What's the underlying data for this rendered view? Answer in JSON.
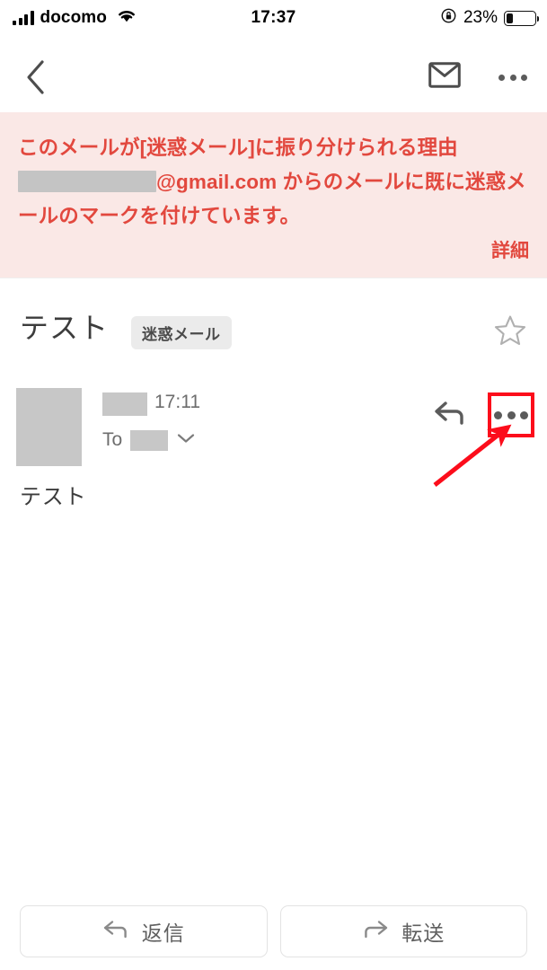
{
  "status_bar": {
    "carrier": "docomo",
    "time": "17:37",
    "battery_percent": "23%",
    "battery_level": 23,
    "signal_icon": "signal-bars-icon",
    "wifi_icon": "wifi-icon",
    "rotation_lock_icon": "rotation-lock-icon"
  },
  "nav_bar": {
    "back_icon": "chevron-left-icon",
    "mail_icon": "envelope-icon",
    "overflow_icon": "more-horizontal-icon"
  },
  "warning_banner": {
    "line1": "このメールが[迷惑メール]に振り分けられる理由",
    "redacted_address_suffix": "@gmail.com からのメールに既に迷惑メ",
    "line3": "ールのマークを付けています。",
    "details_link": "詳細",
    "text_color": "#e2483e",
    "background_color": "#fae8e6"
  },
  "subject_section": {
    "subject": "テスト",
    "spam_badge": "迷惑メール",
    "star_icon": "star-outline-icon"
  },
  "message": {
    "avatar": "sender-avatar-redacted",
    "sender_name_redacted": true,
    "time": "17:11",
    "to_label": "To",
    "to_redacted": true,
    "expand_icon": "chevron-down-icon",
    "reply_icon": "reply-arrow-icon",
    "more_icon": "more-horizontal-icon",
    "body": "テスト"
  },
  "annotation": {
    "highlight_color": "#fc0d1b",
    "highlight_target": "message-more-button",
    "arrow_icon": "pointer-arrow-icon"
  },
  "bottom_bar": {
    "reply_label": "返信",
    "reply_icon": "reply-arrow-icon",
    "forward_label": "転送",
    "forward_icon": "forward-arrow-icon"
  }
}
